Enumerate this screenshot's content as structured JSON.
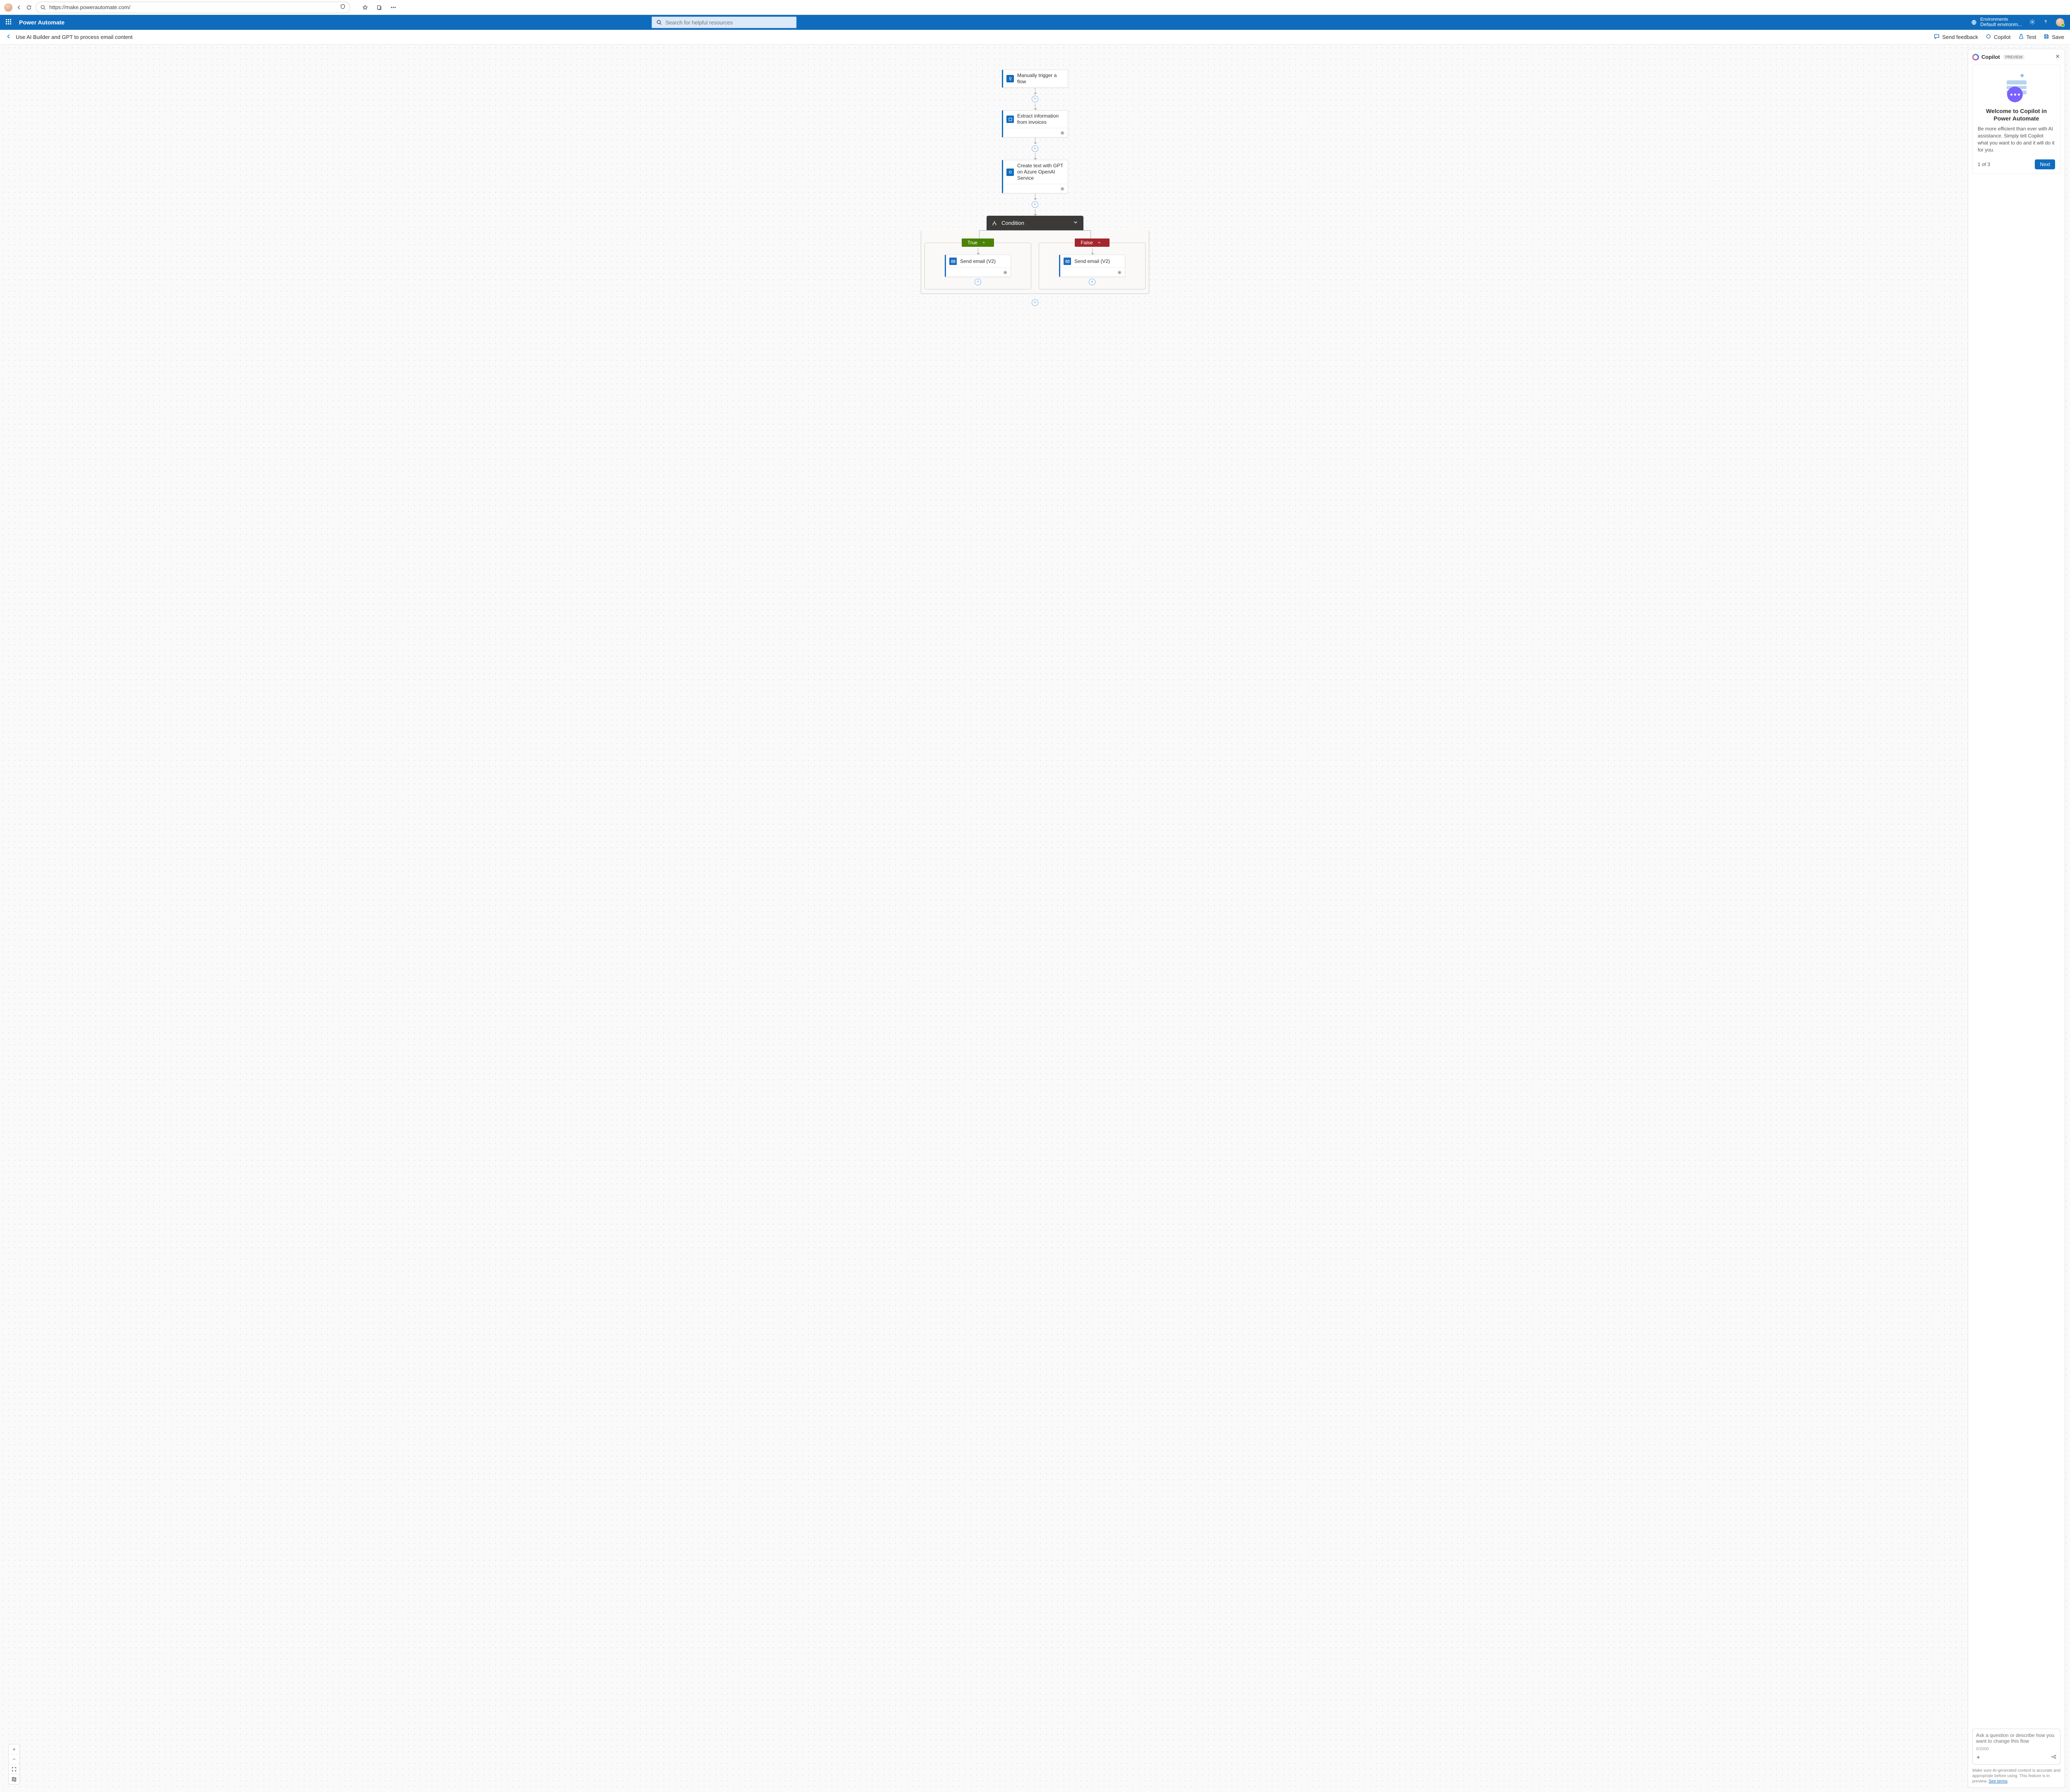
{
  "browser": {
    "url": "https://make.powerautomate.com/"
  },
  "header": {
    "app_title": "Power Automate",
    "search_placeholder": "Search for helpful resources",
    "env_label": "Environments",
    "env_name": "Default environm..."
  },
  "command_bar": {
    "flow_title": "Use AI Builder and GPT to process email content",
    "feedback": "Send feedback",
    "copilot": "Copilot",
    "test": "Test",
    "save": "Save"
  },
  "flow": {
    "trigger": "Manually trigger a flow",
    "step2": "Extract information from invoices",
    "step3": "Create text with GPT on Azure OpenAI Service",
    "condition": "Condition",
    "true_label": "True",
    "false_label": "False",
    "email_true": "Send email (V2)",
    "email_false": "Send email (V2)"
  },
  "copilot": {
    "title": "Copilot",
    "badge": "PREVIEW",
    "card_title": "Welcome to Copilot in Power Automate",
    "card_body": "Be more efficient than ever with AI assistance. Simply tell Copilot what you want to do and it will do it for you.",
    "step": "1 of 3",
    "next": "Next",
    "input_placeholder": "Ask a question or describe how you want to change this flow",
    "counter": "0/2000",
    "disclaimer_pre": "Make sure AI-generated content is accurate and appropriate before using. This feature is in preview. ",
    "see_terms": "See terms"
  }
}
